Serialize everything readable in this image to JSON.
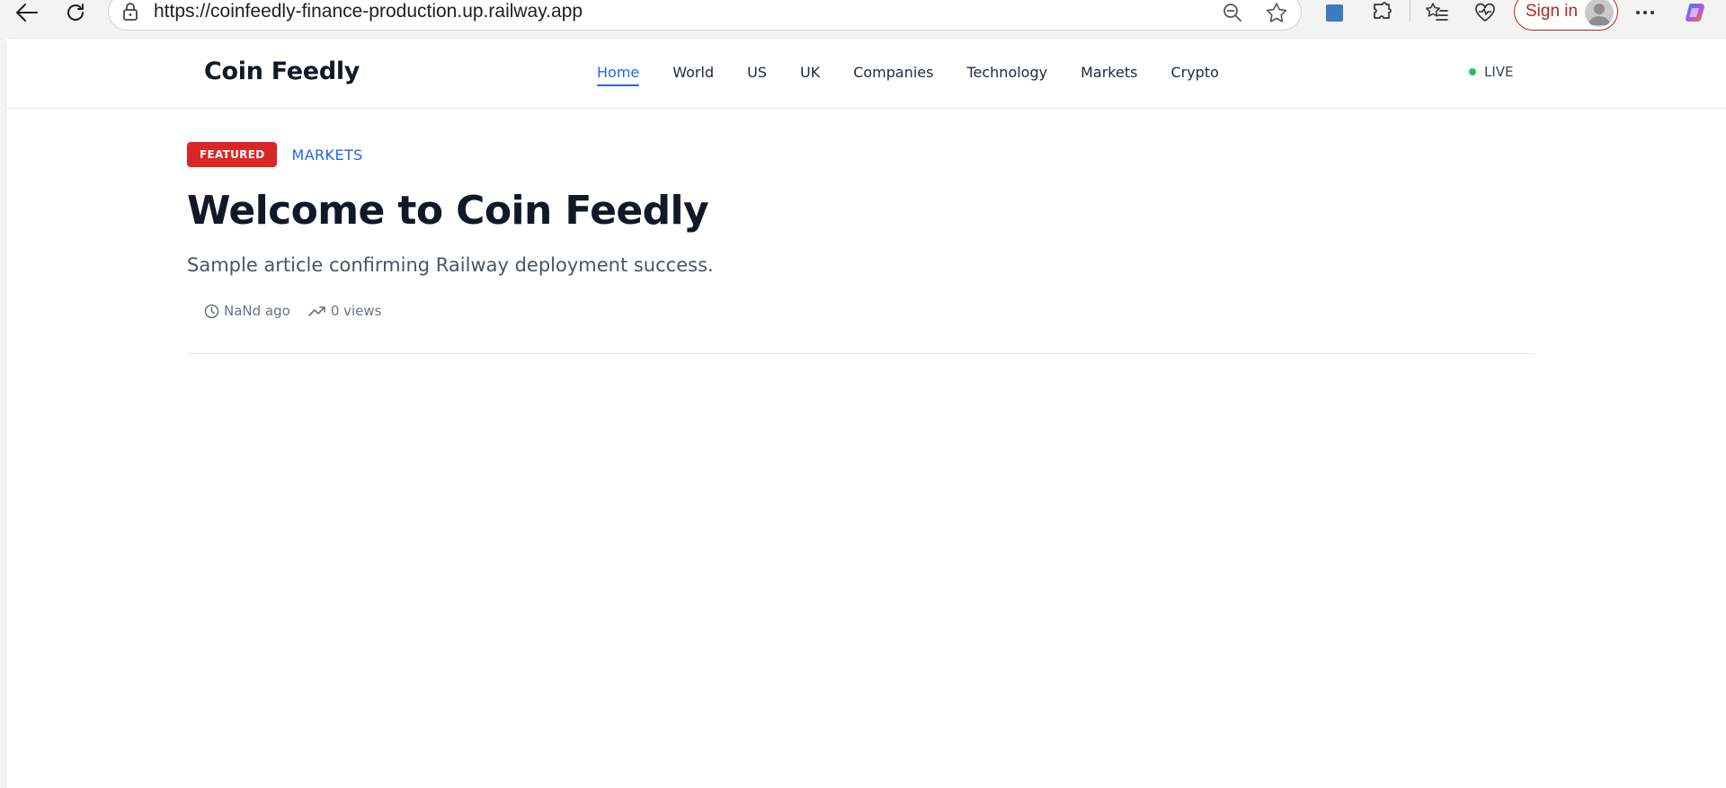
{
  "browser": {
    "url": "https://coinfeedly-finance-production.up.railway.app",
    "sign_in_label": "Sign in",
    "icons": [
      "back-icon",
      "refresh-icon",
      "site-info-icon",
      "zoom-out-icon",
      "favorite-star-icon",
      "extension-square-icon",
      "extensions-puzzle-icon",
      "favorites-list-icon",
      "health-icon",
      "profile-avatar-icon",
      "more-icon",
      "copilot-icon"
    ],
    "colors": {
      "signin_accent": "#b3261e"
    }
  },
  "header": {
    "logo": "Coin Feedly",
    "nav": [
      {
        "label": "Home",
        "active": true
      },
      {
        "label": "World",
        "active": false
      },
      {
        "label": "US",
        "active": false
      },
      {
        "label": "UK",
        "active": false
      },
      {
        "label": "Companies",
        "active": false
      },
      {
        "label": "Technology",
        "active": false
      },
      {
        "label": "Markets",
        "active": false
      },
      {
        "label": "Crypto",
        "active": false
      }
    ],
    "live_label": "LIVE"
  },
  "article": {
    "badge": "FEATURED",
    "category": "MARKETS",
    "title": "Welcome to Coin Feedly",
    "subtitle": "Sample article confirming Railway deployment success.",
    "time_ago": "NaNd ago",
    "views": "0 views"
  },
  "colors": {
    "accent": "#2563eb",
    "badge": "#dc2626",
    "live": "#22c55e",
    "title": "#111827"
  }
}
